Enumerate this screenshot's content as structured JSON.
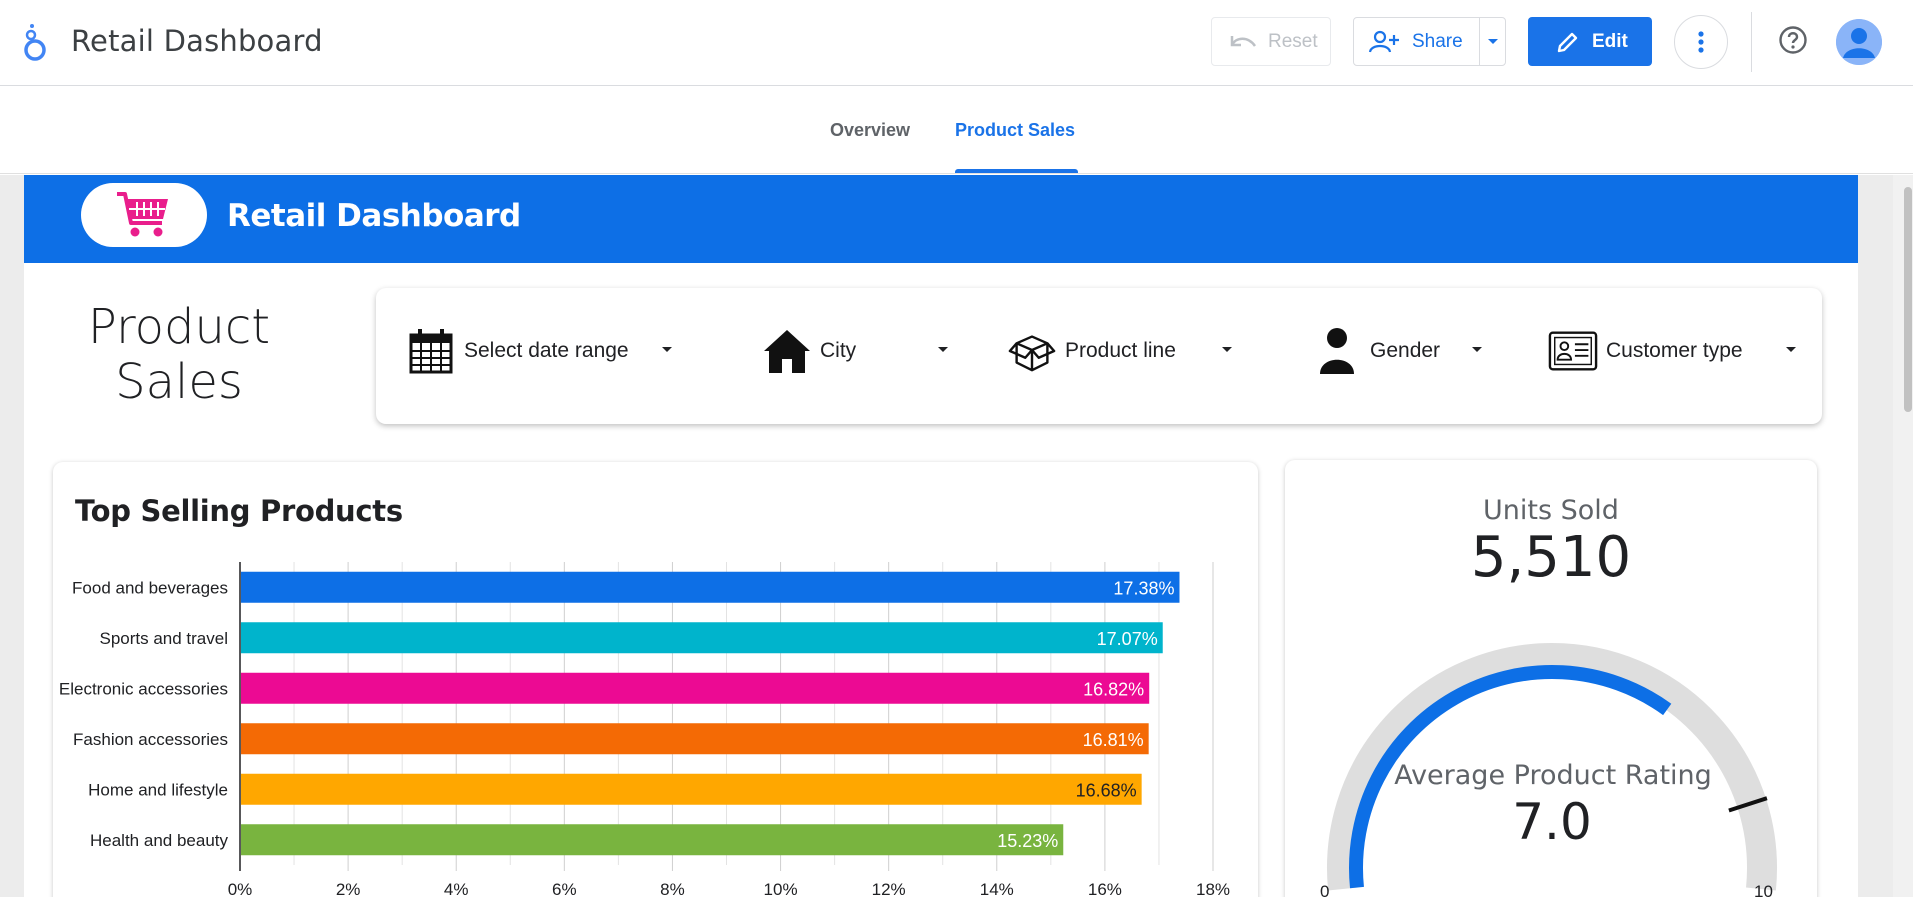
{
  "app": {
    "title": "Retail Dashboard",
    "reset_label": "Reset",
    "share_label": "Share",
    "edit_label": "Edit"
  },
  "tabs": [
    {
      "label": "Overview",
      "active": false
    },
    {
      "label": "Product Sales",
      "active": true
    }
  ],
  "banner": {
    "title": "Retail Dashboard",
    "accent_color": "#0d6fe6",
    "cart_color": "#e91e8c"
  },
  "page": {
    "heading_line1": "Product",
    "heading_line2": "Sales"
  },
  "filters": [
    {
      "label": "Select date range",
      "icon": "calendar-icon"
    },
    {
      "label": "City",
      "icon": "house-icon"
    },
    {
      "label": "Product line",
      "icon": "box-icon"
    },
    {
      "label": "Gender",
      "icon": "person-icon"
    },
    {
      "label": "Customer type",
      "icon": "id-card-icon"
    }
  ],
  "top_selling": {
    "title": "Top Selling Products"
  },
  "units_sold": {
    "label": "Units Sold",
    "value": "5,510"
  },
  "rating": {
    "label": "Average Product Rating",
    "value": "7.0",
    "min_label": "0",
    "max_label": "10",
    "gauge_value": 7.0,
    "gauge_min": 0,
    "gauge_max": 10,
    "target": 9.0
  },
  "chart_data": {
    "type": "bar",
    "orientation": "horizontal",
    "title": "Top Selling Products",
    "categories": [
      "Food and beverages",
      "Sports and travel",
      "Electronic accessories",
      "Fashion accessories",
      "Home and lifestyle",
      "Health and beauty"
    ],
    "values": [
      17.38,
      17.07,
      16.82,
      16.81,
      16.68,
      15.23
    ],
    "value_labels": [
      "17.38%",
      "17.07%",
      "16.82%",
      "16.81%",
      "16.68%",
      "15.23%"
    ],
    "colors": [
      "#0d6fe6",
      "#00b4cc",
      "#ec0a93",
      "#f46a05",
      "#ffa700",
      "#79b43f"
    ],
    "label_colors": [
      "#ffffff",
      "#ffffff",
      "#ffffff",
      "#ffffff",
      "#202124",
      "#ffffff"
    ],
    "xlim": [
      0,
      18
    ],
    "x_ticks": [
      "0%",
      "2%",
      "4%",
      "6%",
      "8%",
      "10%",
      "12%",
      "14%",
      "16%",
      "18%"
    ],
    "grid": true,
    "xlabel": "",
    "ylabel": ""
  }
}
